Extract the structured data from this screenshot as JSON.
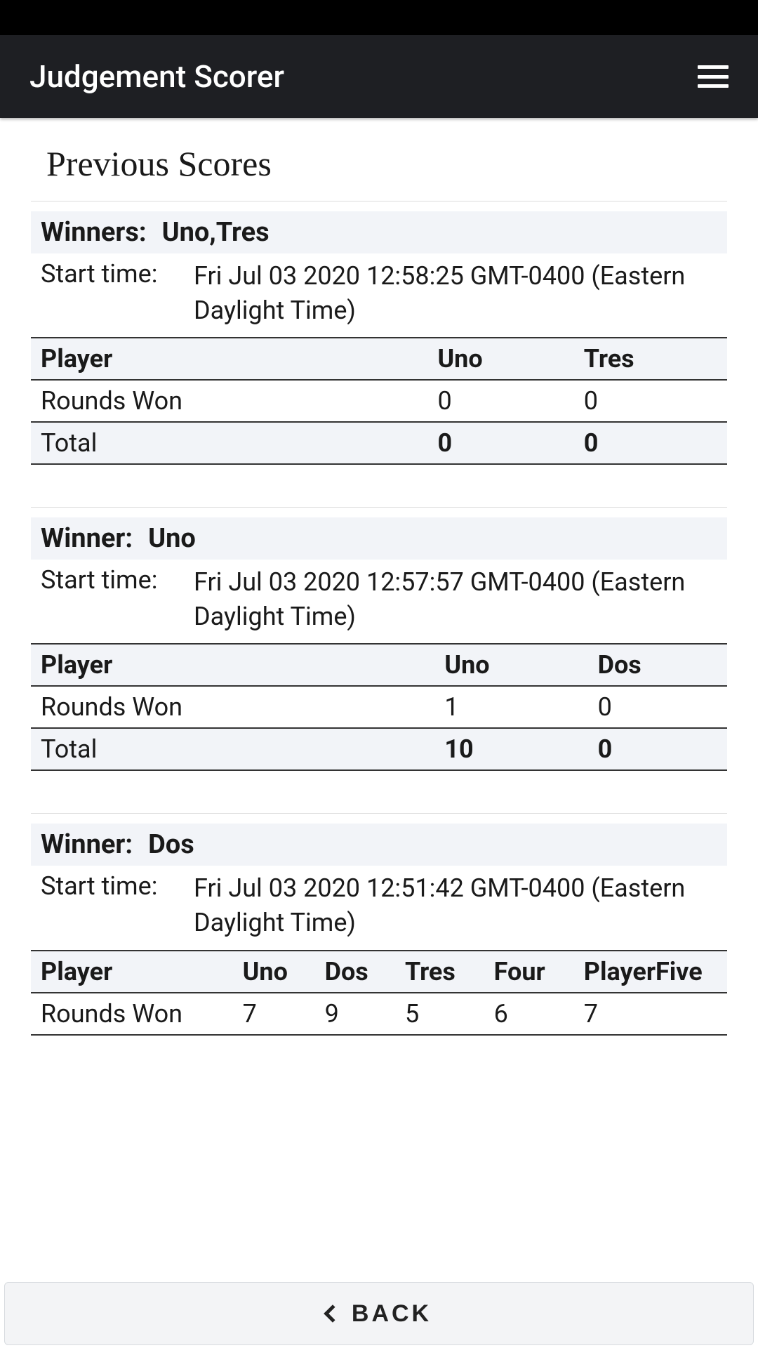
{
  "header": {
    "title": "Judgement Scorer"
  },
  "page": {
    "title": "Previous Scores"
  },
  "games": [
    {
      "winners_label": "Winners:",
      "winners_value": "Uno,Tres",
      "start_label": "Start time:",
      "start_value": "Fri Jul 03 2020 12:58:25 GMT-0400 (Eastern Daylight Time)",
      "player_header": "Player",
      "players": [
        "Uno",
        "Tres"
      ],
      "rounds_label": "Rounds Won",
      "rounds": [
        "0",
        "0"
      ],
      "total_label": "Total",
      "totals": [
        "0",
        "0"
      ]
    },
    {
      "winners_label": "Winner:",
      "winners_value": "Uno",
      "start_label": "Start time:",
      "start_value": "Fri Jul 03 2020 12:57:57 GMT-0400 (Eastern Daylight Time)",
      "player_header": "Player",
      "players": [
        "Uno",
        "Dos"
      ],
      "rounds_label": "Rounds Won",
      "rounds": [
        "1",
        "0"
      ],
      "total_label": "Total",
      "totals": [
        "10",
        "0"
      ]
    },
    {
      "winners_label": "Winner:",
      "winners_value": "Dos",
      "start_label": "Start time:",
      "start_value": "Fri Jul 03 2020 12:51:42 GMT-0400 (Eastern Daylight Time)",
      "player_header": "Player",
      "players": [
        "Uno",
        "Dos",
        "Tres",
        "Four",
        "PlayerFive"
      ],
      "rounds_label": "Rounds Won",
      "rounds": [
        "7",
        "9",
        "5",
        "6",
        "7"
      ]
    }
  ],
  "footer": {
    "back_label": "BACK"
  }
}
